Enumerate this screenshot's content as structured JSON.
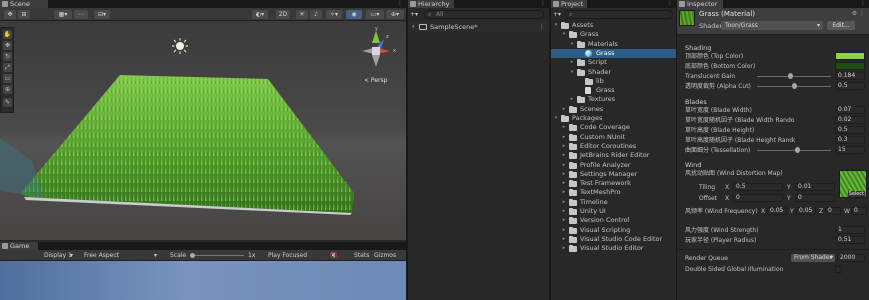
{
  "scene": {
    "tab_label": "Scene",
    "persp_label": "< Persp",
    "gizmo_axes": {
      "y": "y",
      "x": "x",
      "z": "z"
    }
  },
  "game": {
    "tab_label": "Game",
    "display": "Display 1",
    "aspect": "Free Aspect",
    "scale_label": "Scale",
    "scale_value": "1x",
    "play_focused": "Play Focused",
    "stats": "Stats",
    "gizmos": "Gizmos"
  },
  "hierarchy": {
    "tab_label": "Hierarchy",
    "search_placeholder": "All",
    "scene_name": "SampleScene*"
  },
  "project": {
    "tab_label": "Project",
    "items": [
      {
        "label": "Assets",
        "indent": 0,
        "icon": "folder",
        "expanded": true
      },
      {
        "label": "Grass",
        "indent": 1,
        "icon": "folder",
        "expanded": true
      },
      {
        "label": "Materials",
        "indent": 2,
        "icon": "folder",
        "expanded": true
      },
      {
        "label": "Grass",
        "indent": 3,
        "icon": "material",
        "selected": true
      },
      {
        "label": "Script",
        "indent": 2,
        "icon": "folder",
        "expanded": false
      },
      {
        "label": "Shader",
        "indent": 2,
        "icon": "folder",
        "expanded": true
      },
      {
        "label": "lib",
        "indent": 3,
        "icon": "folder"
      },
      {
        "label": "Grass",
        "indent": 3,
        "icon": "file"
      },
      {
        "label": "Textures",
        "indent": 2,
        "icon": "folder",
        "expanded": false
      },
      {
        "label": "Scenes",
        "indent": 1,
        "icon": "folder",
        "expanded": false
      },
      {
        "label": "Packages",
        "indent": 0,
        "icon": "folder",
        "expanded": true
      },
      {
        "label": "Code Coverage",
        "indent": 1,
        "icon": "folder",
        "expanded": false
      },
      {
        "label": "Custom NUnit",
        "indent": 1,
        "icon": "folder",
        "expanded": false
      },
      {
        "label": "Editor Coroutines",
        "indent": 1,
        "icon": "folder",
        "expanded": false
      },
      {
        "label": "JetBrains Rider Editor",
        "indent": 1,
        "icon": "folder",
        "expanded": false
      },
      {
        "label": "Profile Analyzer",
        "indent": 1,
        "icon": "folder",
        "expanded": false
      },
      {
        "label": "Settings Manager",
        "indent": 1,
        "icon": "folder",
        "expanded": false
      },
      {
        "label": "Test Framework",
        "indent": 1,
        "icon": "folder",
        "expanded": false
      },
      {
        "label": "TextMeshPro",
        "indent": 1,
        "icon": "folder",
        "expanded": false
      },
      {
        "label": "Timeline",
        "indent": 1,
        "icon": "folder",
        "expanded": false
      },
      {
        "label": "Unity UI",
        "indent": 1,
        "icon": "folder",
        "expanded": false
      },
      {
        "label": "Version Control",
        "indent": 1,
        "icon": "folder",
        "expanded": false
      },
      {
        "label": "Visual Scripting",
        "indent": 1,
        "icon": "folder",
        "expanded": false
      },
      {
        "label": "Visual Studio Code Editor",
        "indent": 1,
        "icon": "folder",
        "expanded": false
      },
      {
        "label": "Visual Studio Editor",
        "indent": 1,
        "icon": "folder",
        "expanded": false
      }
    ]
  },
  "inspector": {
    "tab_label": "Inspector",
    "title": "Grass (Material)",
    "shader_label": "Shader",
    "shader_value": "Toon/Grass",
    "edit_label": "Edit...",
    "shading": {
      "header": "Shading",
      "top_color": {
        "label": "顶部颜色 (Top Color)",
        "color": "#8ed14a"
      },
      "bottom_color": {
        "label": "底部颜色 (Bottom Color)",
        "color": "#1f4d12"
      },
      "translucent_gain": {
        "label": "Translucent Gain",
        "value": "0.184",
        "fraction": 0.45
      },
      "alpha_cutoff": {
        "label": "透明度裁剪 (Alpha Cut)",
        "value": "0.5",
        "fraction": 0.5
      }
    },
    "blades": {
      "header": "Blades",
      "blade_width": {
        "label": "草叶宽度 (Blade Width)",
        "value": "0.07"
      },
      "width_random": {
        "label": "草叶宽度随机因子 (Blade Width Random)",
        "value": "0.02"
      },
      "blade_height": {
        "label": "草叶高度 (Blade Height)",
        "value": "0.5"
      },
      "height_random": {
        "label": "草叶高度随机因子 (Blade Height Random)",
        "value": "0.3"
      },
      "tessellation": {
        "label": "曲面细分 (Tessellation)",
        "value": "15",
        "fraction": 0.55
      }
    },
    "wind": {
      "header": "Wind",
      "distortion_map": {
        "label": "风扰动贴图 (Wind Distortion Map)"
      },
      "tiling": {
        "label": "Tiling",
        "x": "0.5",
        "y": "0.01"
      },
      "offset": {
        "label": "Offset",
        "x": "0",
        "y": "0"
      },
      "frequency": {
        "label": "风频率 (Wind Frequency)",
        "x": "0.05",
        "y": "0.05",
        "z": "0",
        "w": "0"
      },
      "strength": {
        "label": "风力强度 (Wind Strength)",
        "value": "1"
      },
      "player_radius": {
        "label": "玩家半径 (Player Radius)",
        "value": "0.51"
      }
    },
    "render_queue": {
      "label": "Render Queue",
      "dropdown": "From Shader",
      "value": "2000"
    },
    "double_sided": {
      "label": "Double Sided Global Illumination"
    }
  }
}
